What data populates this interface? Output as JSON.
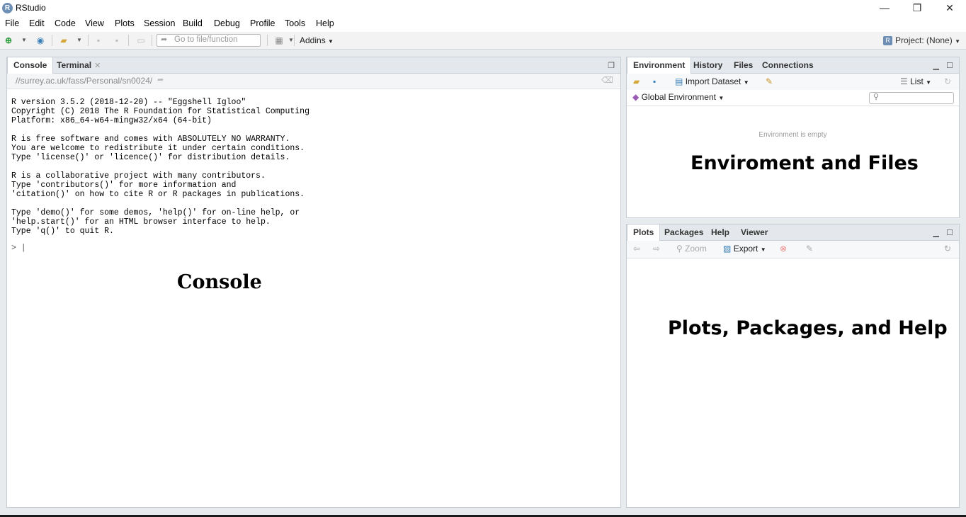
{
  "window": {
    "title": "RStudio",
    "minimize": "—",
    "maximize": "❐",
    "close": "✕"
  },
  "menu": {
    "file": "File",
    "edit": "Edit",
    "code": "Code",
    "view": "View",
    "plots": "Plots",
    "session": "Session",
    "build": "Build",
    "debug": "Debug",
    "profile": "Profile",
    "tools": "Tools",
    "help": "Help"
  },
  "toolbar": {
    "goto_placeholder": "Go to file/function",
    "addins": "Addins",
    "project": "Project: (None)"
  },
  "console_pane": {
    "tabs": [
      "Console",
      "Terminal"
    ],
    "path": "//surrey.ac.uk/fass/Personal/sn0024/",
    "output": "R version 3.5.2 (2018-12-20) -- \"Eggshell Igloo\"\nCopyright (C) 2018 The R Foundation for Statistical Computing\nPlatform: x86_64-w64-mingw32/x64 (64-bit)\n\nR is free software and comes with ABSOLUTELY NO WARRANTY.\nYou are welcome to redistribute it under certain conditions.\nType 'license()' or 'licence()' for distribution details.\n\nR is a collaborative project with many contributors.\nType 'contributors()' for more information and\n'citation()' on how to cite R or R packages in publications.\n\nType 'demo()' for some demos, 'help()' for on-line help, or\n'help.start()' for an HTML browser interface to help.\nType 'q()' to quit R.",
    "prompt": "> |",
    "overlay_label": "Console"
  },
  "env_pane": {
    "tabs": [
      "Environment",
      "History",
      "Files",
      "Connections"
    ],
    "import_dataset": "Import Dataset",
    "list_view": "List",
    "global_env": "Global Environment",
    "empty_text": "Environment is empty",
    "overlay_label": "Enviroment and Files"
  },
  "plots_pane": {
    "tabs": [
      "Plots",
      "Packages",
      "Help",
      "Viewer"
    ],
    "zoom": "Zoom",
    "export": "Export",
    "overlay_label": "Plots, Packages, and Help"
  }
}
